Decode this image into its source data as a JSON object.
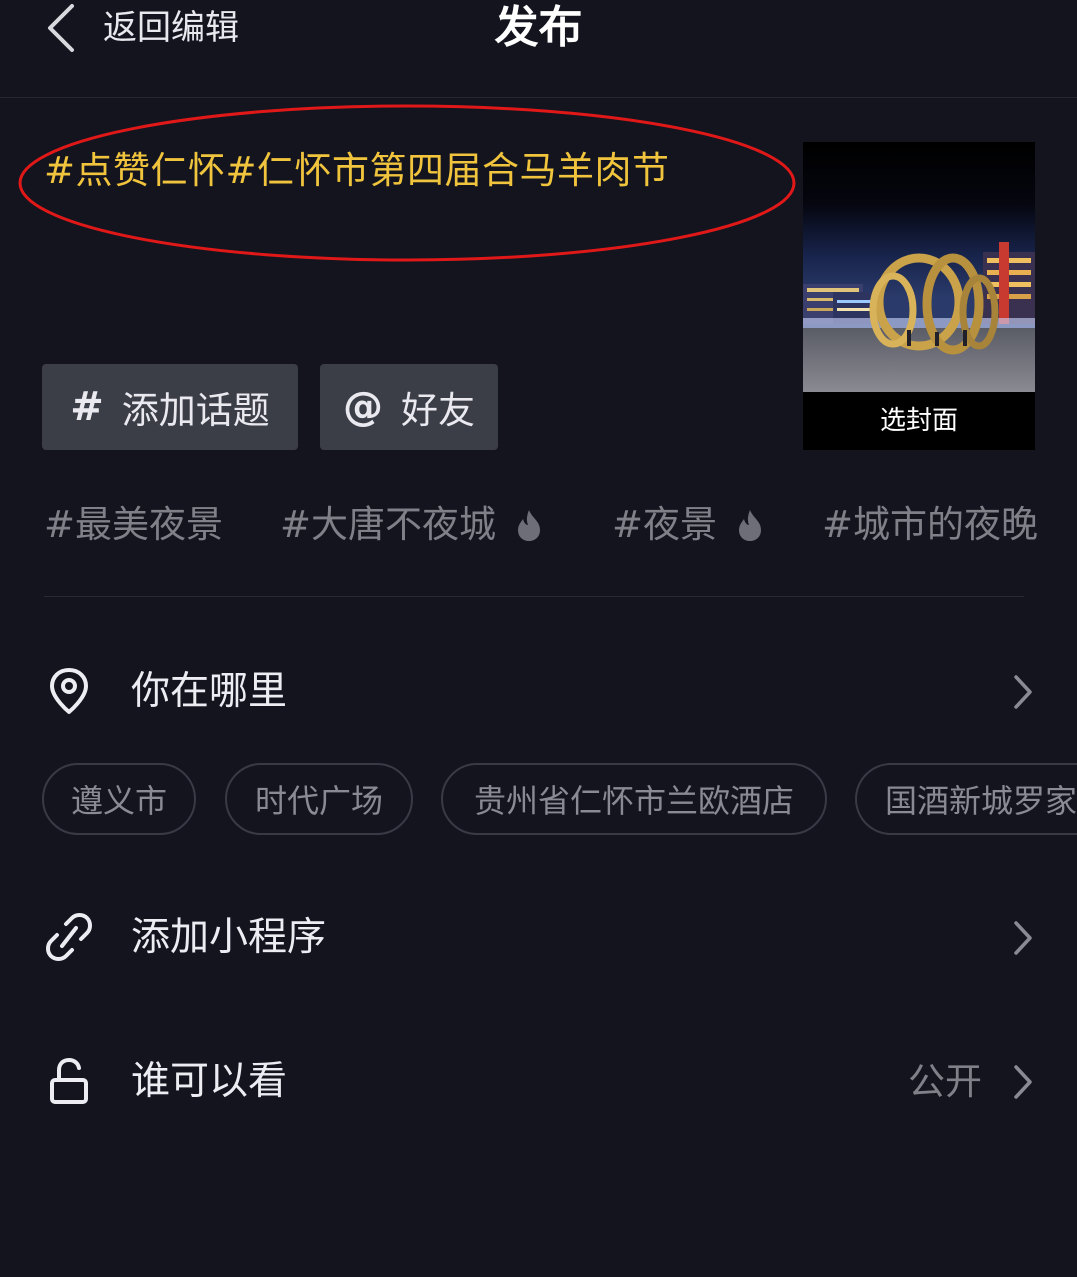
{
  "header": {
    "back_label": "返回编辑",
    "title": "发布"
  },
  "caption": {
    "text": "#点赞仁怀#仁怀市第四届合马羊肉节",
    "highlight_color": "#f0c43c"
  },
  "cover": {
    "label": "选封面"
  },
  "actions": {
    "topic_symbol": "#",
    "topic_label": "添加话题",
    "friend_symbol": "@",
    "friend_label": "好友"
  },
  "suggested_topics": [
    {
      "text": "#最美夜景",
      "hot": false
    },
    {
      "text": "#大唐不夜城",
      "hot": true
    },
    {
      "text": "#夜景",
      "hot": true
    },
    {
      "text": "#城市的夜晚",
      "hot": false
    }
  ],
  "location": {
    "label": "你在哪里",
    "chips": [
      "遵义市",
      "时代广场",
      "贵州省仁怀市兰欧酒店",
      "国酒新城罗家"
    ]
  },
  "mini_program": {
    "label": "添加小程序"
  },
  "visibility": {
    "label": "谁可以看",
    "value": "公开"
  },
  "icons": {
    "back": "chevron-left-icon",
    "location": "location-pin-icon",
    "mini_program": "link-icon",
    "visibility": "unlock-icon",
    "chevron": "chevron-right-icon",
    "fire": "fire-icon"
  }
}
